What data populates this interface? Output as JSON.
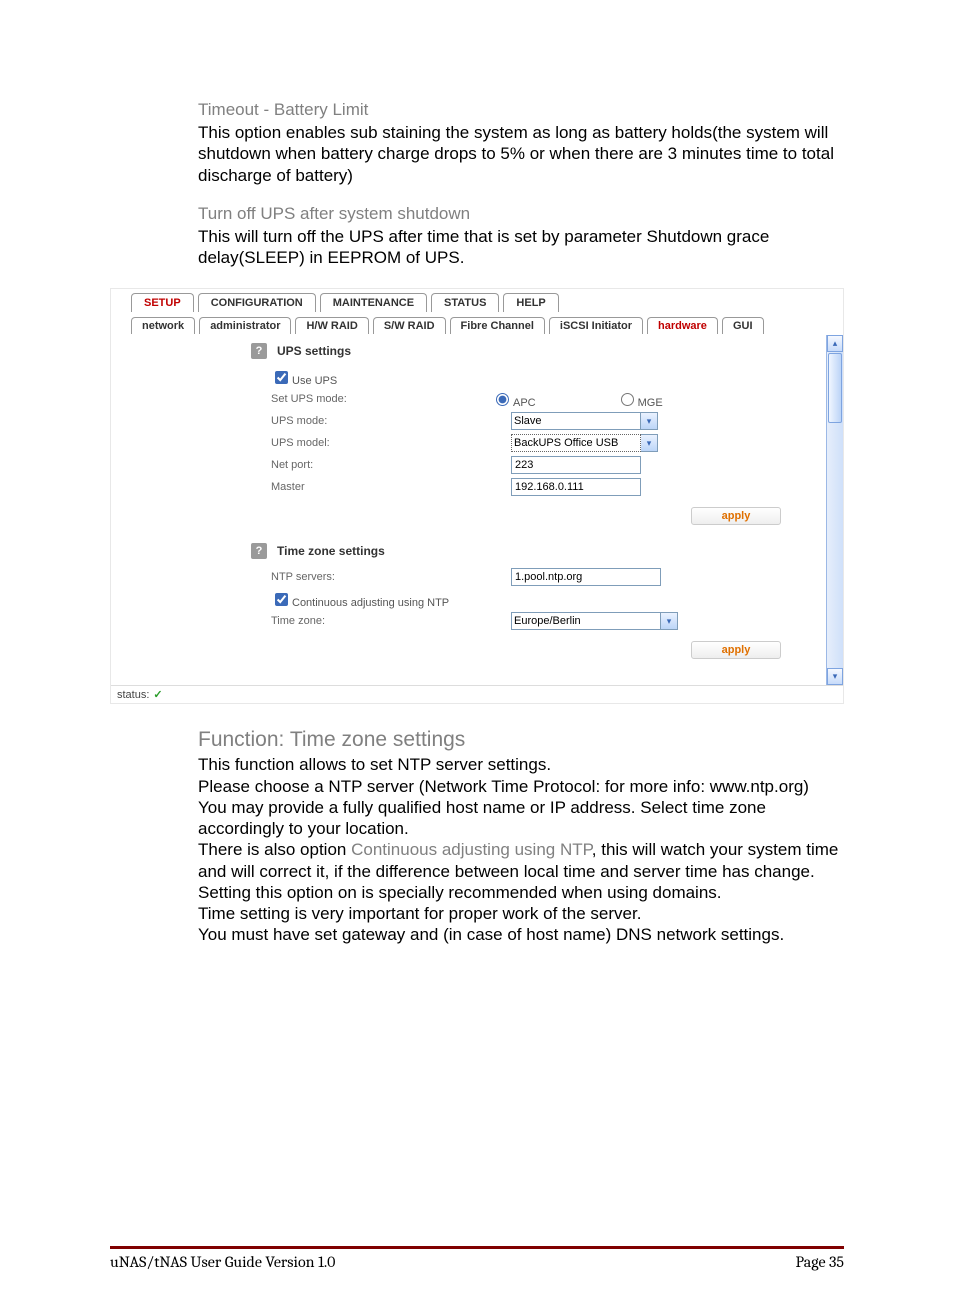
{
  "doc": {
    "sec1_head": "Timeout - Battery Limit",
    "sec1_body": "This option enables sub staining the system as long as battery holds(the system will shutdown when battery charge drops to 5% or when there are 3 minutes time to total discharge of battery)",
    "sec2_head": "Turn off UPS after system shutdown",
    "sec2_body": "This will turn off the UPS after time that is set by parameter Shutdown grace delay(SLEEP) in EEPROM of UPS.",
    "sec3_head": "Function: Time zone settings",
    "sec3_p1": "This function allows to set NTP server settings.",
    "sec3_p2": "Please choose a NTP server (Network Time Protocol: for more info: www.ntp.org)",
    "sec3_p3": "You may provide a fully qualified host name or IP address. Select time zone accordingly to your location.",
    "sec3_p4a": "There is also option ",
    "sec3_p4b": "Continuous adjusting using NTP",
    "sec3_p4c": ", this will watch your system time and will correct it, if the difference between local time and server time has change. Setting this option on is specially recommended when using domains.",
    "sec3_p5": "Time setting is very important for proper work of the server.",
    "sec3_p6": "You must have set gateway and (in case of host name) DNS network settings.",
    "footer_left": "uNAS/tNAS User Guide Version 1.0",
    "footer_right": "Page 35"
  },
  "ui": {
    "main_tabs": [
      "SETUP",
      "CONFIGURATION",
      "MAINTENANCE",
      "STATUS",
      "HELP"
    ],
    "sub_tabs": [
      "network",
      "administrator",
      "H/W RAID",
      "S/W RAID",
      "Fibre Channel",
      "iSCSI Initiator",
      "hardware",
      "GUI"
    ],
    "help_badge": "?",
    "ups": {
      "title": "UPS settings",
      "use_label": "Use UPS",
      "set_mode_label": "Set UPS mode:",
      "radio_apc": "APC",
      "radio_mge": "MGE",
      "mode_label": "UPS mode:",
      "mode_value": "Slave",
      "model_label": "UPS model:",
      "model_value": "BackUPS Office USB",
      "netport_label": "Net port:",
      "netport_value": "223",
      "master_label": "Master",
      "master_value": "192.168.0.111",
      "apply": "apply"
    },
    "tz": {
      "title": "Time zone settings",
      "ntp_label": "NTP servers:",
      "ntp_value": "1.pool.ntp.org",
      "cont_label": "Continuous adjusting using NTP",
      "tz_label": "Time zone:",
      "tz_value": "Europe/Berlin",
      "apply": "apply"
    },
    "status_label": "status:"
  }
}
